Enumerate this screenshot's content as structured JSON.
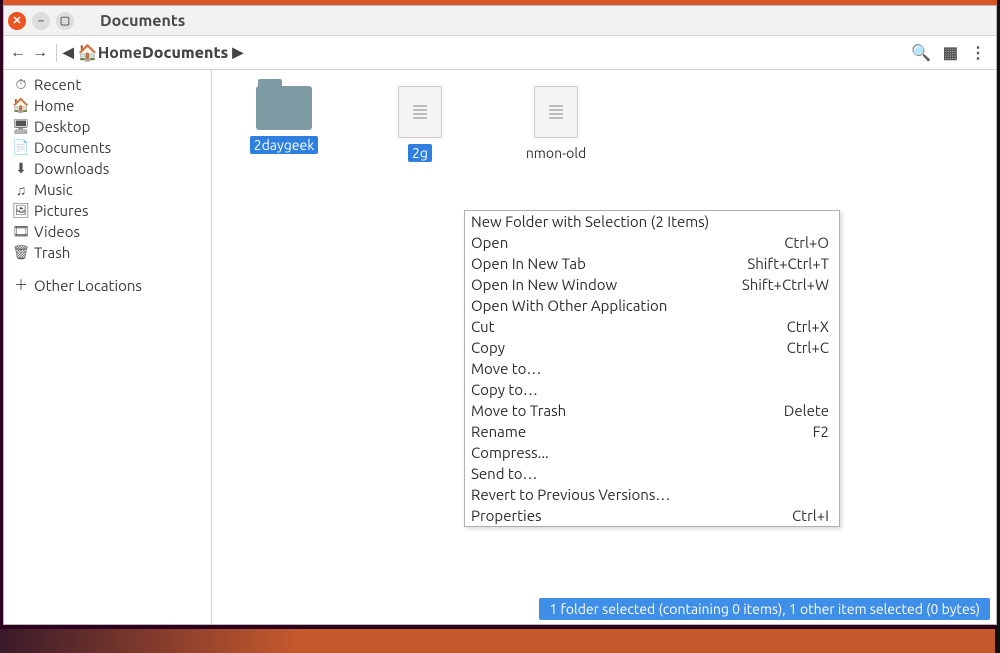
{
  "window": {
    "title": "Documents"
  },
  "toolbar": {
    "breadcrumb": {
      "home": "Home",
      "current": "Documents"
    }
  },
  "sidebar": {
    "items": [
      {
        "icon": "⏱",
        "label": "Recent"
      },
      {
        "icon": "🏠",
        "label": "Home"
      },
      {
        "icon": "🖥",
        "label": "Desktop"
      },
      {
        "icon": "📄",
        "label": "Documents"
      },
      {
        "icon": "⬇",
        "label": "Downloads"
      },
      {
        "icon": "♫",
        "label": "Music"
      },
      {
        "icon": "🖼",
        "label": "Pictures"
      },
      {
        "icon": "🎞",
        "label": "Videos"
      },
      {
        "icon": "🗑",
        "label": "Trash"
      }
    ],
    "other": {
      "icon": "＋",
      "label": "Other Locations"
    }
  },
  "files": [
    {
      "type": "folder",
      "name": "2daygeek",
      "selected": true
    },
    {
      "type": "file",
      "name": "2g",
      "selected": true
    },
    {
      "type": "file",
      "name": "nmon-old",
      "selected": false
    }
  ],
  "context_menu": [
    {
      "label": "New Folder with Selection (2 Items)",
      "accel": ""
    },
    {
      "label": "Open",
      "accel": "Ctrl+O"
    },
    {
      "label": "Open In New Tab",
      "accel": "Shift+Ctrl+T"
    },
    {
      "label": "Open In New Window",
      "accel": "Shift+Ctrl+W"
    },
    {
      "label": "Open With Other Application",
      "accel": ""
    },
    {
      "label": "Cut",
      "accel": "Ctrl+X"
    },
    {
      "label": "Copy",
      "accel": "Ctrl+C"
    },
    {
      "label": "Move to…",
      "accel": ""
    },
    {
      "label": "Copy to…",
      "accel": ""
    },
    {
      "label": "Move to Trash",
      "accel": "Delete"
    },
    {
      "label": "Rename",
      "accel": "F2"
    },
    {
      "label": "Compress...",
      "accel": ""
    },
    {
      "label": "Send to…",
      "accel": ""
    },
    {
      "label": "Revert to Previous Versions…",
      "accel": ""
    },
    {
      "label": "Properties",
      "accel": "Ctrl+I"
    }
  ],
  "status": "1 folder selected (containing 0 items), 1 other item selected (0 bytes)"
}
